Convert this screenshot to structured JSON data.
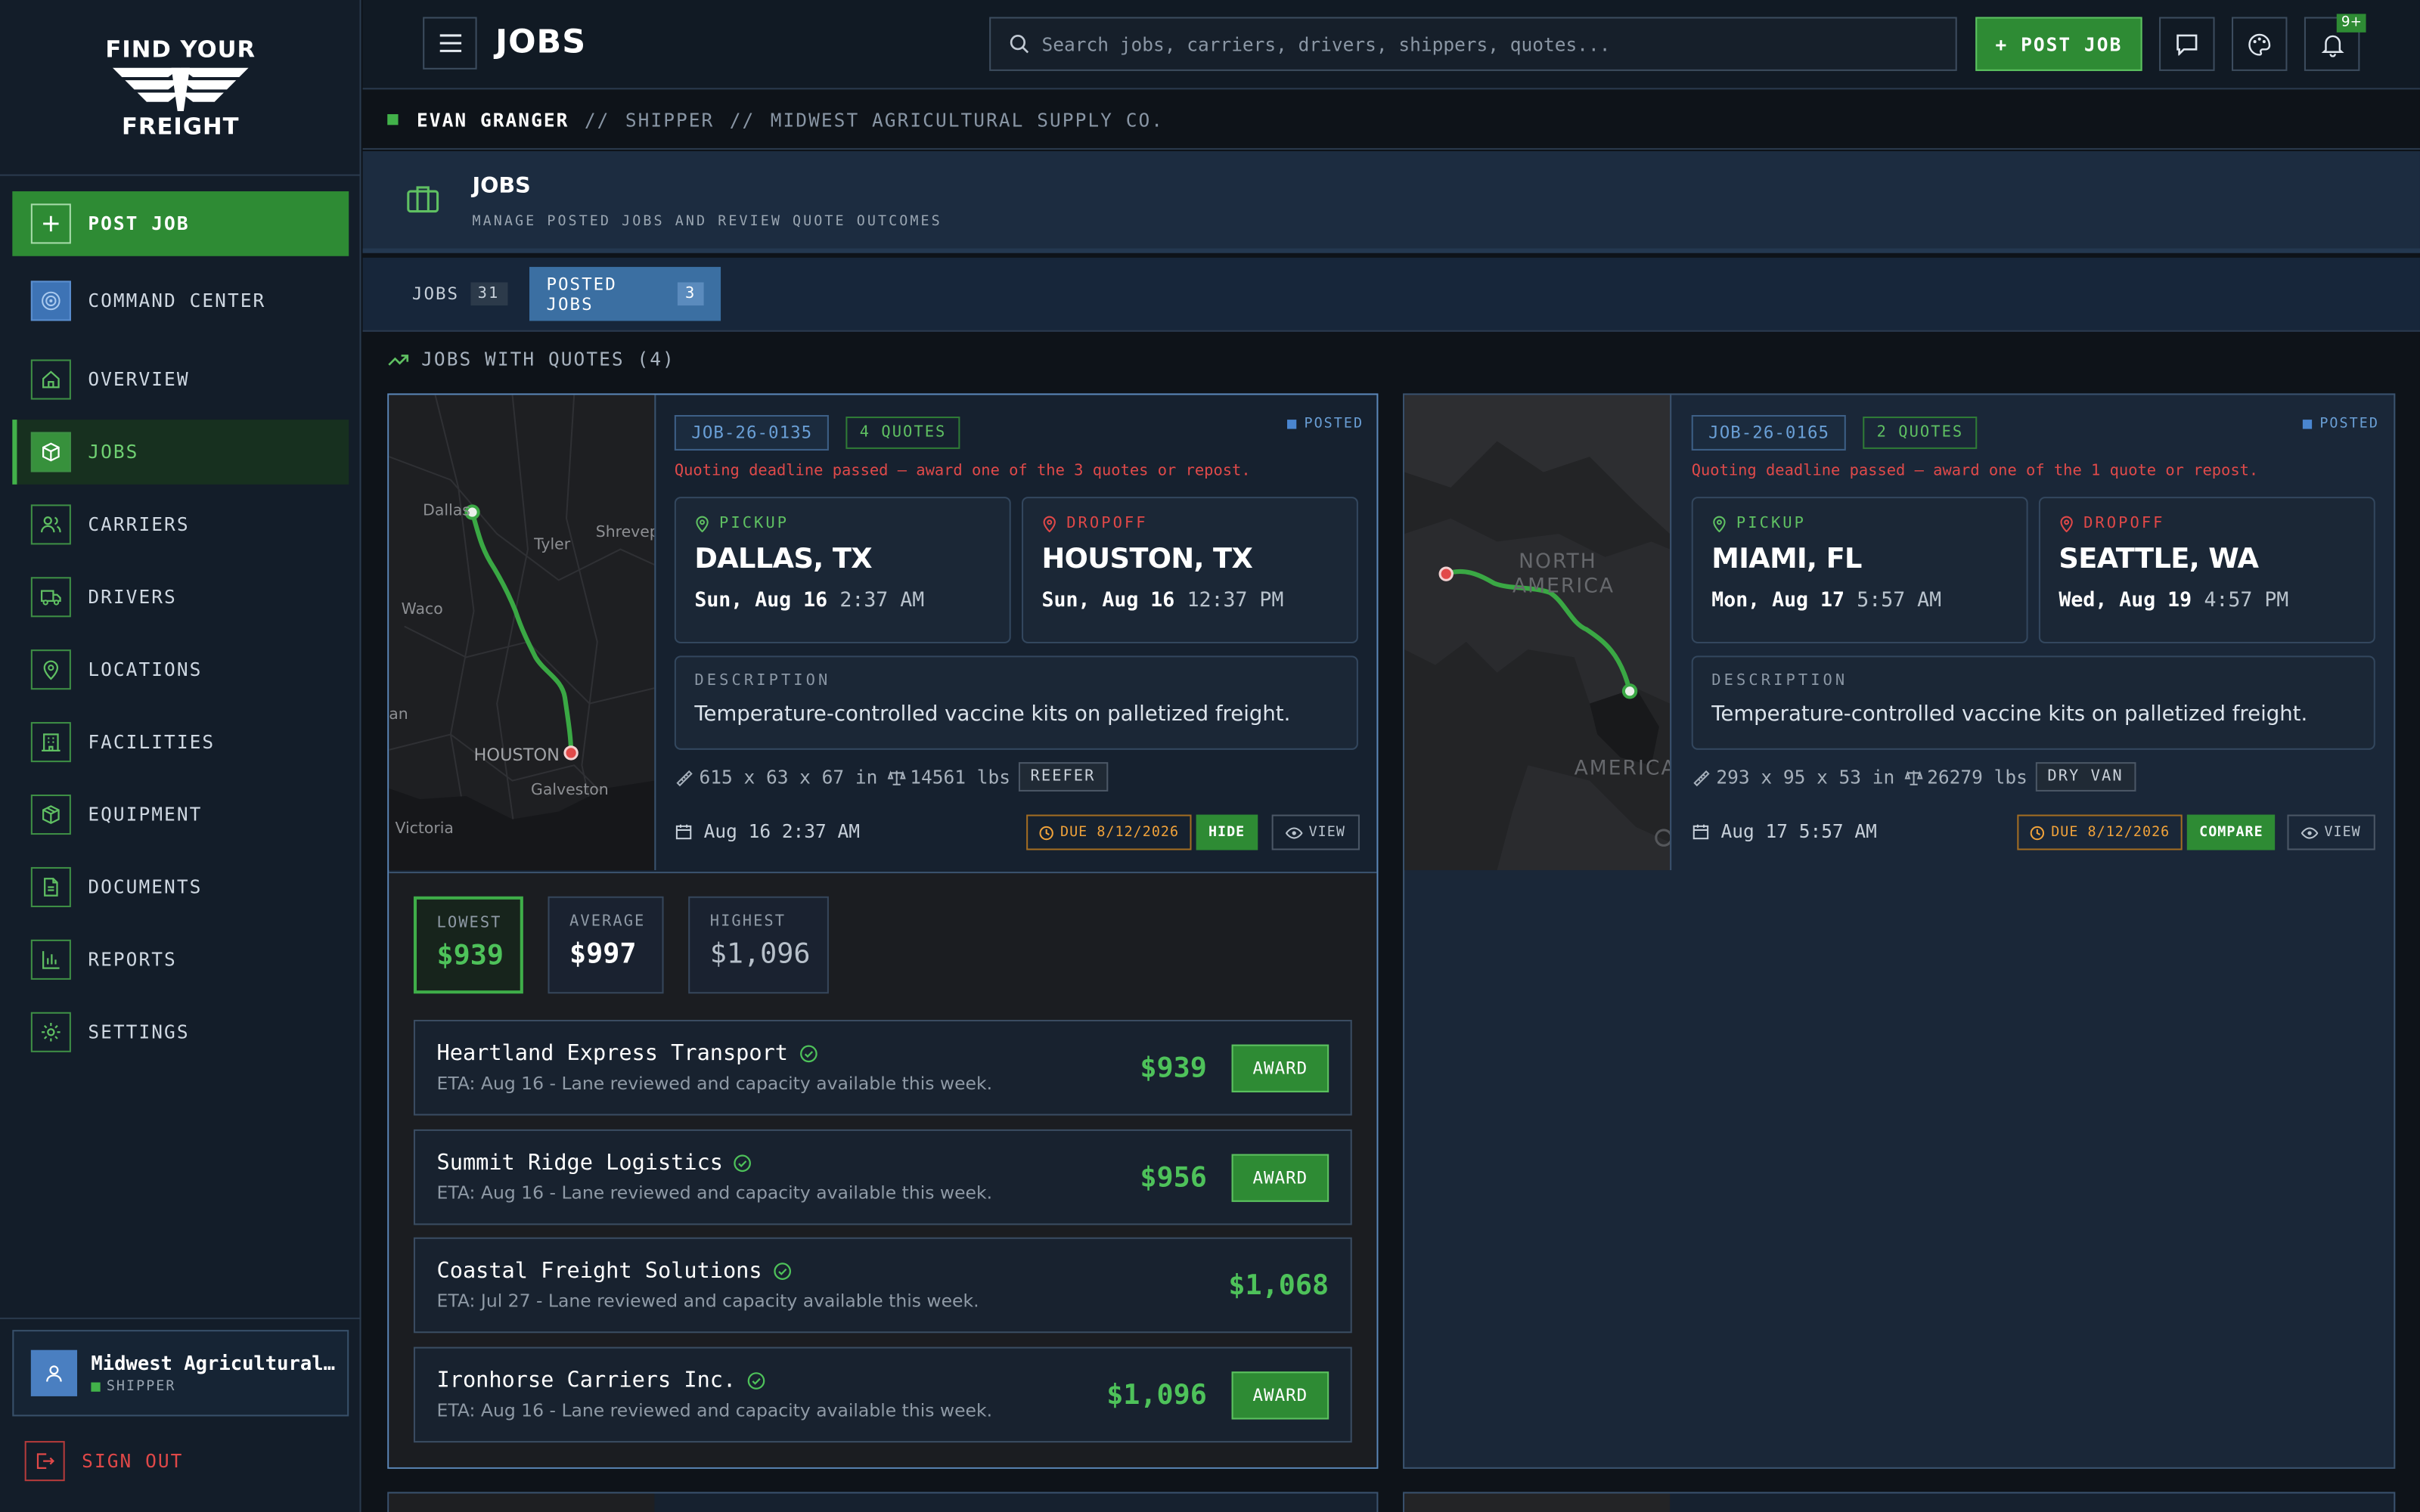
{
  "brand": {
    "logo_line1": "FIND YOUR",
    "logo_line2": "FREIGHT"
  },
  "sidebar": {
    "items": [
      {
        "label": "POST JOB",
        "icon": "plus-icon"
      },
      {
        "label": "COMMAND CENTER",
        "icon": "fingerprint-icon"
      },
      {
        "label": "OVERVIEW",
        "icon": "home-icon"
      },
      {
        "label": "JOBS",
        "icon": "package-icon"
      },
      {
        "label": "CARRIERS",
        "icon": "users-icon"
      },
      {
        "label": "DRIVERS",
        "icon": "truck-icon"
      },
      {
        "label": "LOCATIONS",
        "icon": "map-pin-icon"
      },
      {
        "label": "FACILITIES",
        "icon": "building-icon"
      },
      {
        "label": "EQUIPMENT",
        "icon": "box-icon"
      },
      {
        "label": "DOCUMENTS",
        "icon": "document-icon"
      },
      {
        "label": "REPORTS",
        "icon": "bar-chart-icon"
      },
      {
        "label": "SETTINGS",
        "icon": "gear-icon"
      }
    ],
    "user": {
      "name": "Midwest Agricultural…",
      "role": "SHIPPER"
    },
    "signout": "SIGN OUT"
  },
  "topbar": {
    "title": "JOBS",
    "search_placeholder": "Search jobs, carriers, drivers, shippers, quotes...",
    "post_job": "+ POST JOB",
    "notif_badge": "9+"
  },
  "breadcrumb": {
    "user": "EVAN GRANGER",
    "sep": "//",
    "role": "SHIPPER",
    "company": "MIDWEST AGRICULTURAL SUPPLY CO."
  },
  "page_header": {
    "title": "JOBS",
    "subtitle": "MANAGE POSTED JOBS AND REVIEW QUOTE OUTCOMES"
  },
  "tabs": [
    {
      "label": "JOBS",
      "count": "31"
    },
    {
      "label": "POSTED JOBS",
      "count": "3"
    }
  ],
  "section_title": "JOBS WITH QUOTES (4)",
  "labels": {
    "pickup": "PICKUP",
    "dropoff": "DROPOFF",
    "description": "DESCRIPTION",
    "view": "VIEW",
    "award": "AWARD"
  },
  "jobs": [
    {
      "id": "JOB-26-0135",
      "quotes": "4 QUOTES",
      "status": "POSTED",
      "deadline": "Quoting deadline passed — award one of the 3 quotes or repost.",
      "pickup": {
        "city": "DALLAS, TX",
        "day": "Sun, Aug 16",
        "time": "2:37 AM"
      },
      "dropoff": {
        "city": "HOUSTON, TX",
        "day": "Sun, Aug 16",
        "time": "12:37 PM"
      },
      "description": "Temperature-controlled vaccine kits on palletized freight.",
      "dims": "615 x 63 x 67 in",
      "weight": "14561 lbs",
      "equipment": "REEFER",
      "date": "Aug 16 2:37 AM",
      "due": "DUE 8/12/2026",
      "action": "HIDE",
      "map_labels": [
        "Dallas",
        "Tyler",
        "Shreveport",
        "Waco",
        "HOUSTON",
        "Galveston",
        "Victoria",
        "an"
      ]
    },
    {
      "id": "JOB-26-0165",
      "quotes": "2 QUOTES",
      "status": "POSTED",
      "deadline": "Quoting deadline passed — award one of the 1 quote or repost.",
      "pickup": {
        "city": "MIAMI, FL",
        "day": "Mon, Aug 17",
        "time": "5:57 AM"
      },
      "dropoff": {
        "city": "SEATTLE, WA",
        "day": "Wed, Aug 19",
        "time": "4:57 PM"
      },
      "description": "Temperature-controlled vaccine kits on palletized freight.",
      "dims": "293 x 95 x 53 in",
      "weight": "26279 lbs",
      "equipment": "DRY VAN",
      "date": "Aug 17 5:57 AM",
      "due": "DUE 8/12/2026",
      "action": "COMPARE",
      "map_labels": [
        "NORTH",
        "AMERICA",
        "AMERICA"
      ]
    }
  ],
  "quote_stats": [
    {
      "label": "LOWEST",
      "value": "$939"
    },
    {
      "label": "AVERAGE",
      "value": "$997"
    },
    {
      "label": "HIGHEST",
      "value": "$1,096"
    }
  ],
  "quotes": [
    {
      "carrier": "Heartland Express Transport",
      "eta": "ETA: Aug 16 - Lane reviewed and capacity available this week.",
      "price": "$939",
      "award": true
    },
    {
      "carrier": "Summit Ridge Logistics",
      "eta": "ETA: Aug 16 - Lane reviewed and capacity available this week.",
      "price": "$956",
      "award": true
    },
    {
      "carrier": "Coastal Freight Solutions",
      "eta": "ETA: Jul 27 - Lane reviewed and capacity available this week.",
      "price": "$1,068",
      "award": false
    },
    {
      "carrier": "Ironhorse Carriers Inc.",
      "eta": "ETA: Aug 16 - Lane reviewed and capacity available this week.",
      "price": "$1,096",
      "award": true
    }
  ],
  "colors": {
    "accent_green": "#2e8b34",
    "accent_blue": "#3b6fa2",
    "danger": "#e04848",
    "warning": "#f0a23a"
  }
}
